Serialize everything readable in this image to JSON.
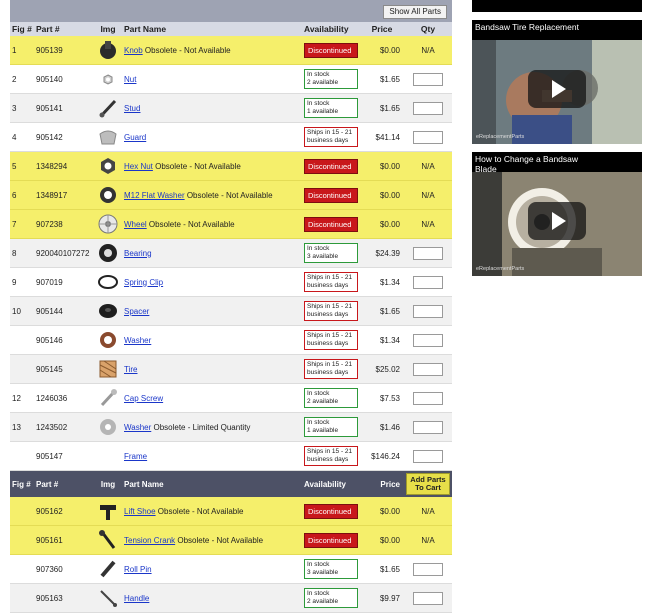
{
  "toolbar": {
    "show_all_label": "Show All Parts"
  },
  "columns": {
    "fig": "Fig #",
    "part": "Part #",
    "img": "Img",
    "name": "Part Name",
    "availability": "Availability",
    "price": "Price",
    "qty": "Qty"
  },
  "columns2": {
    "fig": "Fig #",
    "part": "Part #",
    "img": "Img",
    "name": "Part Name",
    "availability": "Availability",
    "price": "Price",
    "add_to_cart": "Add Parts To Cart"
  },
  "rows": [
    {
      "fig": "1",
      "part": "905139",
      "name": "Knob",
      "note": "Obsolete - Not Available",
      "status": "disc",
      "avail": "Discontinued",
      "price": "$0.00",
      "qty": "N/A",
      "icon": "knob"
    },
    {
      "fig": "2",
      "part": "905140",
      "name": "Nut",
      "note": "",
      "status": "stock",
      "avail": "In stock\n2 available",
      "price": "$1.65",
      "qty": "",
      "icon": "nut"
    },
    {
      "fig": "3",
      "part": "905141",
      "name": "Stud",
      "note": "",
      "status": "stock",
      "avail": "In stock\n1 available",
      "price": "$1.65",
      "qty": "",
      "icon": "stud"
    },
    {
      "fig": "4",
      "part": "905142",
      "name": "Guard",
      "note": "",
      "status": "ship",
      "avail": "Ships in 15 - 21\nbusiness days",
      "price": "$41.14",
      "qty": "",
      "icon": "guard"
    },
    {
      "fig": "5",
      "part": "1348294",
      "name": "Hex Nut",
      "note": "Obsolete - Not Available",
      "status": "disc",
      "avail": "Discontinued",
      "price": "$0.00",
      "qty": "N/A",
      "icon": "hexnut"
    },
    {
      "fig": "6",
      "part": "1348917",
      "name": "M12 Flat Washer",
      "note": "Obsolete - Not Available",
      "status": "disc",
      "avail": "Discontinued",
      "price": "$0.00",
      "qty": "N/A",
      "icon": "washer"
    },
    {
      "fig": "7",
      "part": "907238",
      "name": "Wheel",
      "note": "Obsolete - Not Available",
      "status": "disc",
      "avail": "Discontinued",
      "price": "$0.00",
      "qty": "N/A",
      "icon": "wheel"
    },
    {
      "fig": "8",
      "part": "920040107272",
      "name": "Bearing",
      "note": "",
      "status": "stock",
      "avail": "In stock\n3 available",
      "price": "$24.39",
      "qty": "",
      "icon": "bearing"
    },
    {
      "fig": "9",
      "part": "907019",
      "name": "Spring Clip",
      "note": "",
      "status": "ship",
      "avail": "Ships in 15 - 21\nbusiness days",
      "price": "$1.34",
      "qty": "",
      "icon": "clip"
    },
    {
      "fig": "10",
      "part": "905144",
      "name": "Spacer",
      "note": "",
      "status": "ship",
      "avail": "Ships in 15 - 21\nbusiness days",
      "price": "$1.65",
      "qty": "",
      "icon": "spacer"
    },
    {
      "fig": "",
      "part": "905146",
      "name": "Washer",
      "note": "",
      "status": "ship",
      "avail": "Ships in 15 - 21\nbusiness days",
      "price": "$1.34",
      "qty": "",
      "icon": "washer2"
    },
    {
      "fig": "",
      "part": "905145",
      "name": "Tire",
      "note": "",
      "status": "ship",
      "avail": "Ships in 15 - 21\nbusiness days",
      "price": "$25.02",
      "qty": "",
      "icon": "tire"
    },
    {
      "fig": "12",
      "part": "1246036",
      "name": "Cap Screw",
      "note": "",
      "status": "stock",
      "avail": "In stock\n2 available",
      "price": "$7.53",
      "qty": "",
      "icon": "screw"
    },
    {
      "fig": "13",
      "part": "1243502",
      "name": "Washer",
      "note": "Obsolete - Limited Quantity",
      "status": "stock",
      "avail": "In stock\n1 available",
      "price": "$1.46",
      "qty": "",
      "icon": "washer3"
    },
    {
      "fig": "",
      "part": "905147",
      "name": "Frame",
      "note": "",
      "status": "ship",
      "avail": "Ships in 15 - 21\nbusiness days",
      "price": "$146.24",
      "qty": "",
      "icon": ""
    }
  ],
  "rows2": [
    {
      "fig": "",
      "part": "905162",
      "name": "Lift Shoe",
      "note": "Obsolete - Not Available",
      "status": "disc",
      "avail": "Discontinued",
      "price": "$0.00",
      "qty": "N/A",
      "icon": "liftshoe"
    },
    {
      "fig": "",
      "part": "905161",
      "name": "Tension Crank",
      "note": "Obsolete - Not Available",
      "status": "disc",
      "avail": "Discontinued",
      "price": "$0.00",
      "qty": "N/A",
      "icon": "crank"
    },
    {
      "fig": "",
      "part": "907360",
      "name": "Roll Pin",
      "note": "",
      "status": "stock",
      "avail": "In stock\n3 available",
      "price": "$1.65",
      "qty": "",
      "icon": "pin"
    },
    {
      "fig": "",
      "part": "905163",
      "name": "Handle",
      "note": "",
      "status": "stock",
      "avail": "In stock\n2 available",
      "price": "$9.97",
      "qty": "",
      "icon": "handle"
    }
  ],
  "videos": [
    {
      "title": "Bandsaw Tire Replacement",
      "brand": "eReplacementParts"
    },
    {
      "title": "How to Change a Bandsaw Blade",
      "brand": "eReplacementParts"
    }
  ],
  "colors": {
    "obsolete_row": "#f5ef6b",
    "discontinued": "#c8171b",
    "in_stock_border": "#2d9a3a",
    "header_dark": "#4d5166",
    "link": "#1a36c9"
  }
}
